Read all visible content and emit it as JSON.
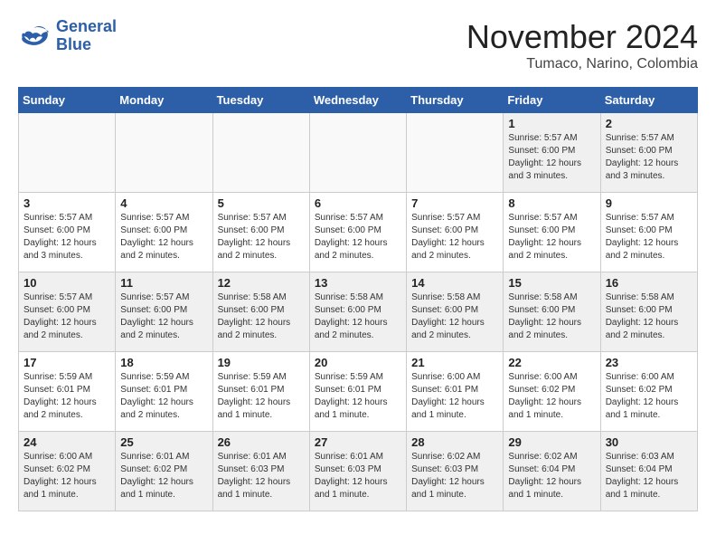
{
  "header": {
    "logo_line1": "General",
    "logo_line2": "Blue",
    "month": "November 2024",
    "location": "Tumaco, Narino, Colombia"
  },
  "weekdays": [
    "Sunday",
    "Monday",
    "Tuesday",
    "Wednesday",
    "Thursday",
    "Friday",
    "Saturday"
  ],
  "weeks": [
    [
      {
        "num": "",
        "info": "",
        "empty": true
      },
      {
        "num": "",
        "info": "",
        "empty": true
      },
      {
        "num": "",
        "info": "",
        "empty": true
      },
      {
        "num": "",
        "info": "",
        "empty": true
      },
      {
        "num": "",
        "info": "",
        "empty": true
      },
      {
        "num": "1",
        "info": "Sunrise: 5:57 AM\nSunset: 6:00 PM\nDaylight: 12 hours\nand 3 minutes.",
        "empty": false
      },
      {
        "num": "2",
        "info": "Sunrise: 5:57 AM\nSunset: 6:00 PM\nDaylight: 12 hours\nand 3 minutes.",
        "empty": false
      }
    ],
    [
      {
        "num": "3",
        "info": "Sunrise: 5:57 AM\nSunset: 6:00 PM\nDaylight: 12 hours\nand 3 minutes.",
        "empty": false
      },
      {
        "num": "4",
        "info": "Sunrise: 5:57 AM\nSunset: 6:00 PM\nDaylight: 12 hours\nand 2 minutes.",
        "empty": false
      },
      {
        "num": "5",
        "info": "Sunrise: 5:57 AM\nSunset: 6:00 PM\nDaylight: 12 hours\nand 2 minutes.",
        "empty": false
      },
      {
        "num": "6",
        "info": "Sunrise: 5:57 AM\nSunset: 6:00 PM\nDaylight: 12 hours\nand 2 minutes.",
        "empty": false
      },
      {
        "num": "7",
        "info": "Sunrise: 5:57 AM\nSunset: 6:00 PM\nDaylight: 12 hours\nand 2 minutes.",
        "empty": false
      },
      {
        "num": "8",
        "info": "Sunrise: 5:57 AM\nSunset: 6:00 PM\nDaylight: 12 hours\nand 2 minutes.",
        "empty": false
      },
      {
        "num": "9",
        "info": "Sunrise: 5:57 AM\nSunset: 6:00 PM\nDaylight: 12 hours\nand 2 minutes.",
        "empty": false
      }
    ],
    [
      {
        "num": "10",
        "info": "Sunrise: 5:57 AM\nSunset: 6:00 PM\nDaylight: 12 hours\nand 2 minutes.",
        "empty": false
      },
      {
        "num": "11",
        "info": "Sunrise: 5:57 AM\nSunset: 6:00 PM\nDaylight: 12 hours\nand 2 minutes.",
        "empty": false
      },
      {
        "num": "12",
        "info": "Sunrise: 5:58 AM\nSunset: 6:00 PM\nDaylight: 12 hours\nand 2 minutes.",
        "empty": false
      },
      {
        "num": "13",
        "info": "Sunrise: 5:58 AM\nSunset: 6:00 PM\nDaylight: 12 hours\nand 2 minutes.",
        "empty": false
      },
      {
        "num": "14",
        "info": "Sunrise: 5:58 AM\nSunset: 6:00 PM\nDaylight: 12 hours\nand 2 minutes.",
        "empty": false
      },
      {
        "num": "15",
        "info": "Sunrise: 5:58 AM\nSunset: 6:00 PM\nDaylight: 12 hours\nand 2 minutes.",
        "empty": false
      },
      {
        "num": "16",
        "info": "Sunrise: 5:58 AM\nSunset: 6:00 PM\nDaylight: 12 hours\nand 2 minutes.",
        "empty": false
      }
    ],
    [
      {
        "num": "17",
        "info": "Sunrise: 5:59 AM\nSunset: 6:01 PM\nDaylight: 12 hours\nand 2 minutes.",
        "empty": false
      },
      {
        "num": "18",
        "info": "Sunrise: 5:59 AM\nSunset: 6:01 PM\nDaylight: 12 hours\nand 2 minutes.",
        "empty": false
      },
      {
        "num": "19",
        "info": "Sunrise: 5:59 AM\nSunset: 6:01 PM\nDaylight: 12 hours\nand 1 minute.",
        "empty": false
      },
      {
        "num": "20",
        "info": "Sunrise: 5:59 AM\nSunset: 6:01 PM\nDaylight: 12 hours\nand 1 minute.",
        "empty": false
      },
      {
        "num": "21",
        "info": "Sunrise: 6:00 AM\nSunset: 6:01 PM\nDaylight: 12 hours\nand 1 minute.",
        "empty": false
      },
      {
        "num": "22",
        "info": "Sunrise: 6:00 AM\nSunset: 6:02 PM\nDaylight: 12 hours\nand 1 minute.",
        "empty": false
      },
      {
        "num": "23",
        "info": "Sunrise: 6:00 AM\nSunset: 6:02 PM\nDaylight: 12 hours\nand 1 minute.",
        "empty": false
      }
    ],
    [
      {
        "num": "24",
        "info": "Sunrise: 6:00 AM\nSunset: 6:02 PM\nDaylight: 12 hours\nand 1 minute.",
        "empty": false
      },
      {
        "num": "25",
        "info": "Sunrise: 6:01 AM\nSunset: 6:02 PM\nDaylight: 12 hours\nand 1 minute.",
        "empty": false
      },
      {
        "num": "26",
        "info": "Sunrise: 6:01 AM\nSunset: 6:03 PM\nDaylight: 12 hours\nand 1 minute.",
        "empty": false
      },
      {
        "num": "27",
        "info": "Sunrise: 6:01 AM\nSunset: 6:03 PM\nDaylight: 12 hours\nand 1 minute.",
        "empty": false
      },
      {
        "num": "28",
        "info": "Sunrise: 6:02 AM\nSunset: 6:03 PM\nDaylight: 12 hours\nand 1 minute.",
        "empty": false
      },
      {
        "num": "29",
        "info": "Sunrise: 6:02 AM\nSunset: 6:04 PM\nDaylight: 12 hours\nand 1 minute.",
        "empty": false
      },
      {
        "num": "30",
        "info": "Sunrise: 6:03 AM\nSunset: 6:04 PM\nDaylight: 12 hours\nand 1 minute.",
        "empty": false
      }
    ]
  ]
}
